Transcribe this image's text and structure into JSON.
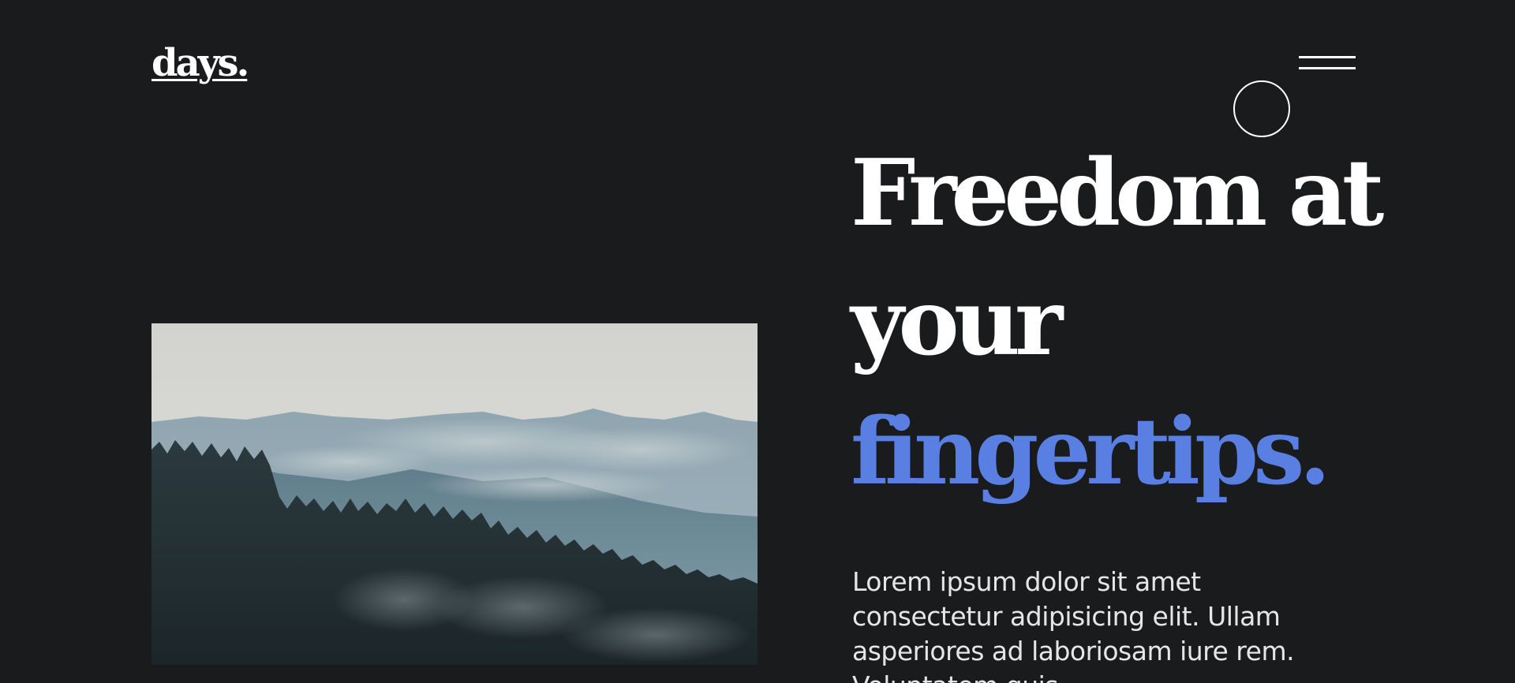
{
  "brand": {
    "logo_text": "days."
  },
  "nav": {
    "menu_icon": "hamburger-menu-icon"
  },
  "hero": {
    "image_alt": "misty mountain forest",
    "headline_line1": "Freedom at",
    "headline_line2": "your",
    "headline_line3": "fingertips.",
    "description": "Lorem ipsum dolor sit amet consectetur adipisicing elit. Ullam asperiores ad laboriosam iure rem. Voluptatem quis",
    "accent_color": "#5a7fe3",
    "background_color": "#1a1b1d"
  }
}
